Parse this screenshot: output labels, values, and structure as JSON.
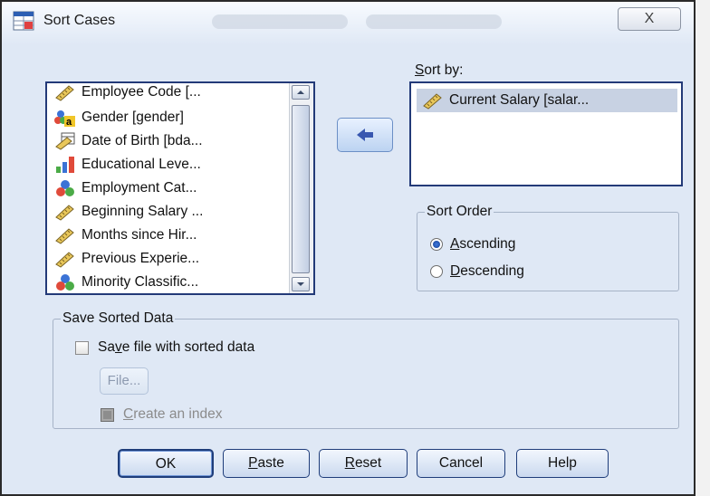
{
  "dialog": {
    "title": "Sort Cases",
    "close_label": "X"
  },
  "variable_list": {
    "items": [
      {
        "label": "Employee Code [...",
        "icon": "scale-ruler-icon"
      },
      {
        "label": "Gender [gender]",
        "icon": "nominal-string-icon"
      },
      {
        "label": "Date of Birth [bda...",
        "icon": "date-ruler-icon"
      },
      {
        "label": "Educational Leve...",
        "icon": "ordinal-bars-icon"
      },
      {
        "label": "Employment Cat...",
        "icon": "nominal-circles-icon"
      },
      {
        "label": "Beginning Salary ...",
        "icon": "scale-ruler-icon"
      },
      {
        "label": "Months since Hir...",
        "icon": "scale-ruler-icon"
      },
      {
        "label": "Previous Experie...",
        "icon": "scale-ruler-icon"
      },
      {
        "label": "Minority Classific...",
        "icon": "nominal-circles-icon"
      }
    ]
  },
  "sort_by": {
    "label_u": "S",
    "label_rest": "ort by:",
    "items": [
      {
        "label": "Current Salary [salar...",
        "icon": "scale-ruler-icon"
      }
    ]
  },
  "sort_order": {
    "legend": "Sort Order",
    "ascending_u": "A",
    "ascending_rest": "scending",
    "descending_u": "D",
    "descending_rest": "escending",
    "selected": "Ascending"
  },
  "save": {
    "legend": "Save Sorted Data",
    "checkbox_pre": "Sa",
    "checkbox_u": "v",
    "checkbox_post": "e file with sorted data",
    "file_button": "File...",
    "index_u": "C",
    "index_rest": "reate an index"
  },
  "buttons": {
    "ok": "OK",
    "paste_u": "P",
    "paste_rest": "aste",
    "reset_u": "R",
    "reset_rest": "eset",
    "cancel": "Cancel",
    "help": "Help"
  }
}
